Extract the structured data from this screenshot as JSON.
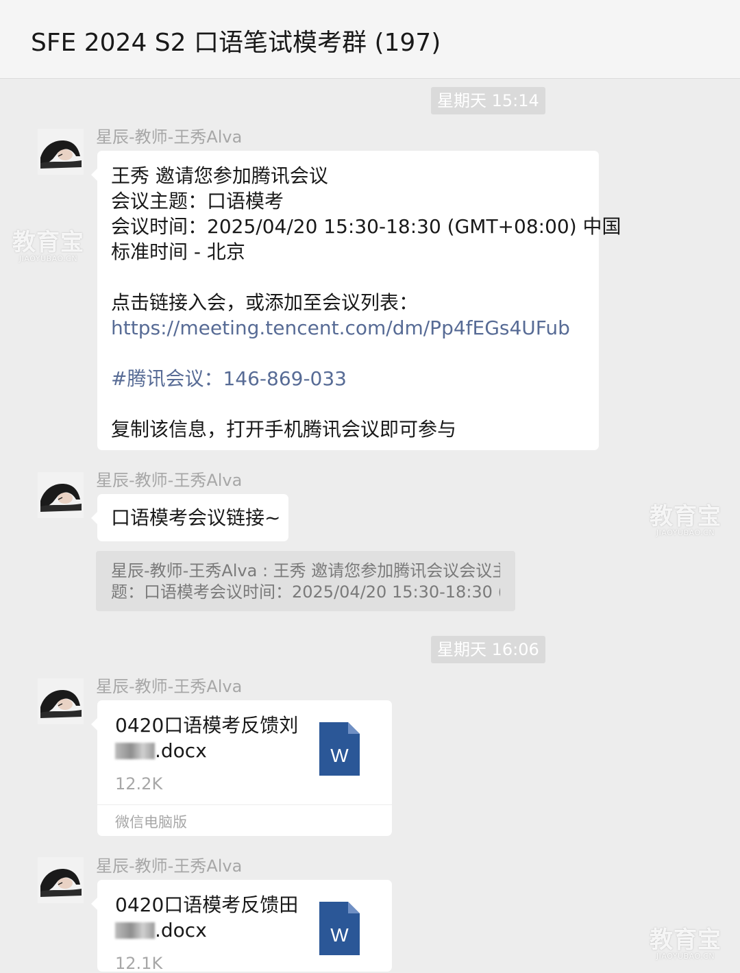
{
  "header": {
    "title": "SFE 2024 S2 口语笔试模考群 (197)"
  },
  "timestamps": [
    "星期天 15:14",
    "星期天 16:06"
  ],
  "messages": [
    {
      "sender": "星辰-教师-王秀Alva",
      "lines": [
        "王秀 邀请您参加腾讯会议",
        "会议主题：口语模考",
        "会议时间：2025/04/20 15:30-18:30 (GMT+08:00) 中国",
        "标准时间 - 北京",
        "点击链接入会，或添加至会议列表：",
        "https://meeting.tencent.com/dm/Pp4fEGs4UFub",
        "#腾讯会议：146-869-033",
        "复制该信息，打开手机腾讯会议即可参与"
      ]
    },
    {
      "sender": "星辰-教师-王秀Alva",
      "text": "口语模考会议链接~",
      "quote_lines": [
        "星辰-教师-王秀Alva : 王秀 邀请您参加腾讯会议会议主",
        "题：口语模考会议时间：2025/04/20 15:30-18:30 (..."
      ]
    },
    {
      "sender": "星辰-教师-王秀Alva",
      "file": {
        "name_line1": "0420口语模考反馈刘",
        "name_line2": ".docx",
        "size": "12.2K",
        "source": "微信电脑版",
        "icon_letter": "W"
      }
    },
    {
      "sender": "星辰-教师-王秀Alva",
      "file": {
        "name_line1": "0420口语模考反馈田",
        "name_line2": ".docx",
        "size": "12.1K",
        "icon_letter": "W"
      }
    }
  ],
  "watermark": {
    "main": "教育宝",
    "sub": "JIAOYUBAO.CN"
  },
  "colors": {
    "link": "#576b95",
    "word_blue": "#2b5797",
    "background": "#ededed"
  }
}
